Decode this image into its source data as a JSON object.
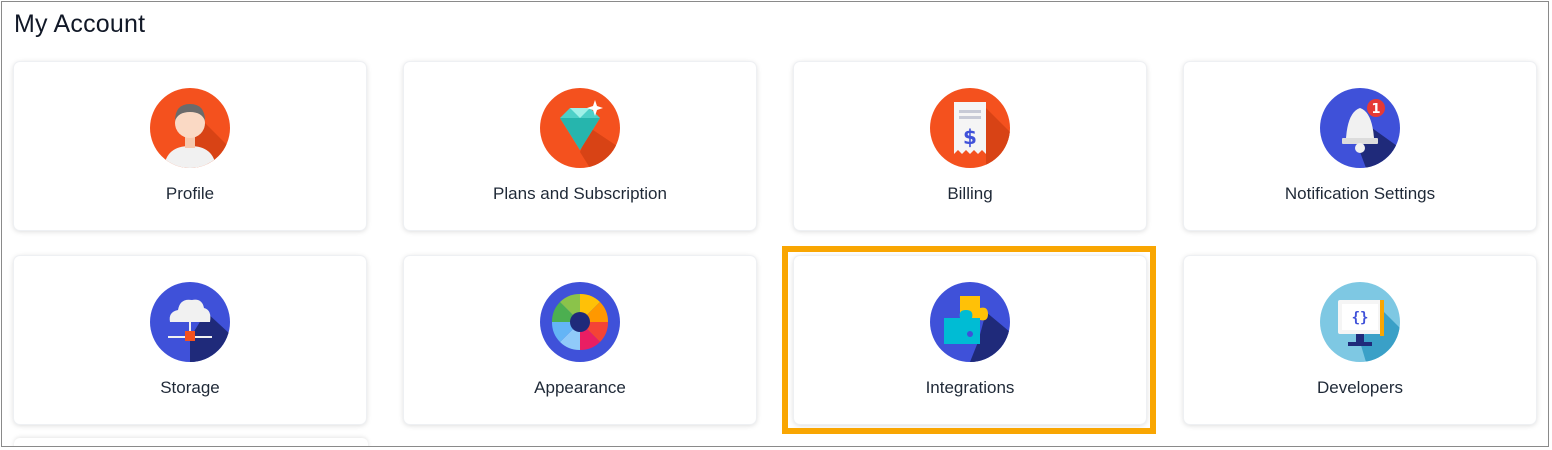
{
  "page": {
    "title": "My Account"
  },
  "cards": [
    {
      "label": "Profile",
      "icon": "profile-icon"
    },
    {
      "label": "Plans and Subscription",
      "icon": "diamond-icon"
    },
    {
      "label": "Billing",
      "icon": "receipt-icon"
    },
    {
      "label": "Notification Settings",
      "icon": "bell-icon"
    },
    {
      "label": "Storage",
      "icon": "cloud-storage-icon"
    },
    {
      "label": "Appearance",
      "icon": "color-wheel-icon"
    },
    {
      "label": "Integrations",
      "icon": "puzzle-icon"
    },
    {
      "label": "Developers",
      "icon": "code-monitor-icon"
    }
  ],
  "notification_badge": "1",
  "highlighted_card": "Integrations",
  "colors": {
    "highlight": "#f9a602",
    "orange": "#f4511e",
    "indigo": "#3f51d9",
    "light_blue": "#7ec8e3"
  }
}
